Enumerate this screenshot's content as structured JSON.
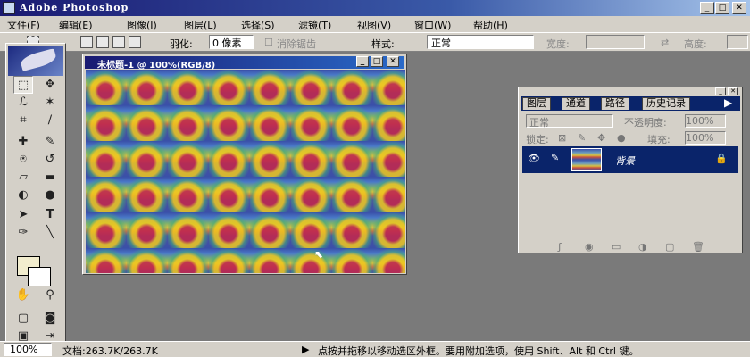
{
  "app": {
    "title": "Adobe Photoshop"
  },
  "menu": [
    "文件(F)",
    "编辑(E)",
    "图像(I)",
    "图层(L)",
    "选择(S)",
    "滤镜(T)",
    "视图(V)",
    "窗口(W)",
    "帮助(H)"
  ],
  "options": {
    "feather_label": "羽化:",
    "feather_value": "0 像素",
    "antialias_label": "消除锯齿",
    "style_label": "样式:",
    "style_value": "正常",
    "width_label": "宽度:",
    "height_label": "高度:"
  },
  "document": {
    "title": "未标题-1 @ 100%(RGB/8)"
  },
  "layers_panel": {
    "tabs": [
      "图层",
      "通道",
      "路径",
      "历史记录"
    ],
    "blend_mode": "正常",
    "opacity_label": "不透明度:",
    "opacity_value": "100%",
    "lock_label": "锁定:",
    "fill_label": "填充:",
    "fill_value": "100%",
    "layer_name": "背景"
  },
  "status": {
    "zoom": "100%",
    "doc_info": "文档:263.7K/263.7K",
    "hint": "点按并拖移以移动选区外框。要用附加选项，使用 Shift、Alt 和 Ctrl 键。"
  },
  "colors": {
    "titlebar": "#1a1a72",
    "panel": "#d4d0c8",
    "workspace": "#7a7a7a",
    "foreground": "#f2edce",
    "background": "#ffffff"
  },
  "icons": [
    "marquee-icon",
    "move-icon",
    "lasso-icon",
    "magic-wand-icon",
    "crop-icon",
    "slice-icon",
    "healing-icon",
    "brush-icon",
    "stamp-icon",
    "history-brush-icon",
    "eraser-icon",
    "gradient-icon",
    "dodge-icon",
    "burn-icon",
    "path-select-icon",
    "type-icon",
    "pen-icon",
    "line-icon",
    "notes-icon",
    "eyedropper-icon",
    "hand-icon",
    "zoom-icon"
  ]
}
